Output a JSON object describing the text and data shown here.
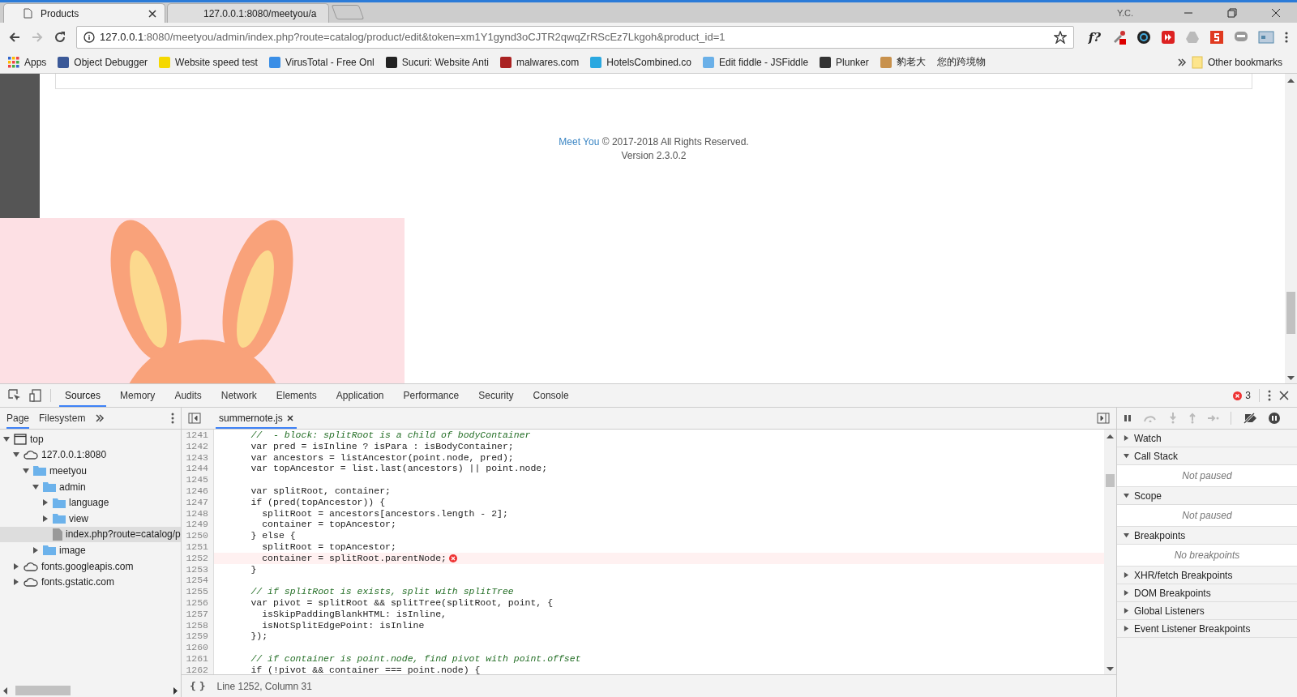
{
  "browser": {
    "tabs": [
      {
        "title": "Products",
        "selected": true
      },
      {
        "title": "127.0.0.1:8080/meetyou/a",
        "selected": false
      }
    ],
    "user": "Y.C.",
    "url": {
      "host": "127.0.0.1",
      "rest": ":8080/meetyou/admin/index.php?route=catalog/product/edit&token=xm1Y1gynd3oCJTR2qwqZrRScEz7Lkgoh&product_id=1"
    },
    "extension_text": "f?",
    "bookmarks": [
      {
        "label": "Apps",
        "kind": "apps"
      },
      {
        "label": "Object Debugger",
        "kind": "blue"
      },
      {
        "label": "Website speed test",
        "kind": "yellow"
      },
      {
        "label": "VirusTotal - Free Onl",
        "kind": "arrow"
      },
      {
        "label": "Sucuri: Website Anti",
        "kind": "dark"
      },
      {
        "label": "malwares.com",
        "kind": "cube"
      },
      {
        "label": "HotelsCombined.co",
        "kind": "cyan"
      },
      {
        "label": "Edit fiddle - JSFiddle",
        "kind": "cloud"
      },
      {
        "label": "Plunker",
        "kind": "download"
      },
      {
        "label": "豹老大",
        "kind": "box"
      },
      {
        "label": "您的跨境物",
        "kind": "none"
      }
    ],
    "other_bookmarks": "Other bookmarks"
  },
  "page": {
    "footer_link": "Meet You",
    "footer_text": " © 2017-2018 All Rights Reserved.",
    "version": "Version 2.3.0.2"
  },
  "devtools": {
    "tabs": [
      {
        "label": "Sources",
        "selected": true
      },
      {
        "label": "Memory",
        "selected": false
      },
      {
        "label": "Audits",
        "selected": false
      },
      {
        "label": "Network",
        "selected": false
      },
      {
        "label": "Elements",
        "selected": false
      },
      {
        "label": "Application",
        "selected": false
      },
      {
        "label": "Performance",
        "selected": false
      },
      {
        "label": "Security",
        "selected": false
      },
      {
        "label": "Console",
        "selected": false
      }
    ],
    "error_count": "3",
    "navigator_tabs": [
      {
        "label": "Page",
        "selected": true
      },
      {
        "label": "Filesystem",
        "selected": false
      }
    ],
    "tree": [
      {
        "label": "top",
        "kind": "frame",
        "expanded": true,
        "selected": false,
        "children": [
          {
            "label": "127.0.0.1:8080",
            "kind": "cloud",
            "expanded": true,
            "selected": false,
            "children": [
              {
                "label": "meetyou",
                "kind": "folder",
                "expanded": true,
                "selected": false,
                "children": [
                  {
                    "label": "admin",
                    "kind": "folder",
                    "expanded": true,
                    "selected": false,
                    "children": [
                      {
                        "label": "language",
                        "kind": "folder",
                        "expanded": false,
                        "selected": false
                      },
                      {
                        "label": "view",
                        "kind": "folder",
                        "expanded": false,
                        "selected": false
                      },
                      {
                        "label": "index.php?route=catalog/p",
                        "kind": "file",
                        "selected": true
                      }
                    ]
                  },
                  {
                    "label": "image",
                    "kind": "folder",
                    "expanded": false,
                    "selected": false
                  }
                ]
              }
            ]
          },
          {
            "label": "fonts.googleapis.com",
            "kind": "cloud",
            "expanded": false,
            "selected": false
          },
          {
            "label": "fonts.gstatic.com",
            "kind": "cloud",
            "expanded": false,
            "selected": false
          }
        ]
      }
    ],
    "file_tab": "summernote.js",
    "code": [
      {
        "n": "1241",
        "kind": "comment",
        "text": "      //  - block: splitRoot is a child of bodyContainer",
        "error": false
      },
      {
        "n": "1242",
        "kind": "code",
        "text": "      var pred = isInline ? isPara : isBodyContainer;",
        "error": false
      },
      {
        "n": "1243",
        "kind": "code",
        "text": "      var ancestors = listAncestor(point.node, pred);",
        "error": false
      },
      {
        "n": "1244",
        "kind": "code",
        "text": "      var topAncestor = list.last(ancestors) || point.node;",
        "error": false
      },
      {
        "n": "1245",
        "error": false
      },
      {
        "n": "1246",
        "kind": "code",
        "text": "      var splitRoot, container;",
        "error": false
      },
      {
        "n": "1247",
        "kind": "code",
        "text": "      if (pred(topAncestor)) {",
        "error": false
      },
      {
        "n": "1248",
        "kind": "code",
        "text": "        splitRoot = ancestors[ancestors.length - 2];",
        "error": false
      },
      {
        "n": "1249",
        "kind": "code",
        "text": "        container = topAncestor;",
        "error": false
      },
      {
        "n": "1250",
        "kind": "code",
        "text": "      } else {",
        "error": false
      },
      {
        "n": "1251",
        "kind": "code",
        "text": "        splitRoot = topAncestor;",
        "error": false
      },
      {
        "n": "1252",
        "kind": "code",
        "text": "        container = splitRoot.parentNode;",
        "error": true
      },
      {
        "n": "1253",
        "kind": "code",
        "text": "      }",
        "error": false
      },
      {
        "n": "1254",
        "error": false
      },
      {
        "n": "1255",
        "kind": "comment",
        "text": "      // if splitRoot is exists, split with splitTree",
        "error": false
      },
      {
        "n": "1256",
        "kind": "code",
        "text": "      var pivot = splitRoot && splitTree(splitRoot, point, {",
        "error": false
      },
      {
        "n": "1257",
        "kind": "code",
        "text": "        isSkipPaddingBlankHTML: isInline,",
        "error": false
      },
      {
        "n": "1258",
        "kind": "code",
        "text": "        isNotSplitEdgePoint: isInline",
        "error": false
      },
      {
        "n": "1259",
        "kind": "code",
        "text": "      });",
        "error": false
      },
      {
        "n": "1260",
        "error": false
      },
      {
        "n": "1261",
        "kind": "comment",
        "text": "      // if container is point.node, find pivot with point.offset",
        "error": false
      },
      {
        "n": "1262",
        "kind": "code",
        "text": "      if (!pivot && container === point.node) {",
        "error": false
      }
    ],
    "pretty_print": "{ }",
    "status": "Line 1252, Column 31",
    "sidebar": [
      {
        "title": "Watch",
        "expanded": false
      },
      {
        "title": "Call Stack",
        "expanded": true,
        "body": "Not paused"
      },
      {
        "title": "Scope",
        "expanded": true,
        "body": "Not paused"
      },
      {
        "title": "Breakpoints",
        "expanded": true,
        "body": "No breakpoints"
      },
      {
        "title": "XHR/fetch Breakpoints",
        "expanded": false
      },
      {
        "title": "DOM Breakpoints",
        "expanded": false
      },
      {
        "title": "Global Listeners",
        "expanded": false
      },
      {
        "title": "Event Listener Breakpoints",
        "expanded": false
      }
    ]
  }
}
